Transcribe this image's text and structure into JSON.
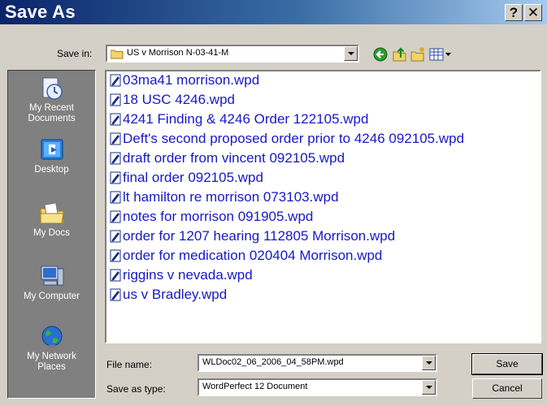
{
  "window": {
    "title": "Save As",
    "help_label": "?",
    "close_label": "✕"
  },
  "save_in": {
    "label": "Save in:",
    "folder": "US v Morrison N-03-41-M"
  },
  "toolbar": {
    "back_icon": "back-arrow-icon",
    "up_icon": "up-folder-icon",
    "new_folder_icon": "new-folder-icon",
    "views_icon": "views-menu-icon"
  },
  "places": [
    {
      "label": "My Recent\nDocuments",
      "icon": "recent-documents-icon"
    },
    {
      "label": "Desktop",
      "icon": "desktop-icon"
    },
    {
      "label": "My Docs",
      "icon": "my-docs-icon"
    },
    {
      "label": "My Computer",
      "icon": "my-computer-icon"
    },
    {
      "label": "My Network\nPlaces",
      "icon": "network-places-icon"
    }
  ],
  "files": [
    "03ma41 morrison.wpd",
    "18 USC 4246.wpd",
    "4241 Finding & 4246 Order 122105.wpd",
    "Deft's second proposed order prior to 4246 092105.wpd",
    "draft order from vincent 092105.wpd",
    "final order 092105.wpd",
    "lt hamilton re morrison 073103.wpd",
    "notes for morrison 091905.wpd",
    "order  for 1207 hearing 112805 Morrison.wpd",
    "order for medication 020404 Morrison.wpd",
    "riggins v nevada.wpd",
    "us v Bradley.wpd"
  ],
  "file_name": {
    "label": "File name:",
    "value": "WLDoc02_06_2006_04_58PM.wpd"
  },
  "save_as_type": {
    "label": "Save as type:",
    "value": "WordPerfect 12 Document"
  },
  "buttons": {
    "save": "Save",
    "cancel": "Cancel"
  },
  "colors": {
    "title_start": "#0a246a",
    "title_end": "#a6caf0",
    "link_blue": "#1818c8",
    "places_bg": "#808080",
    "face": "#d4d0c8"
  }
}
